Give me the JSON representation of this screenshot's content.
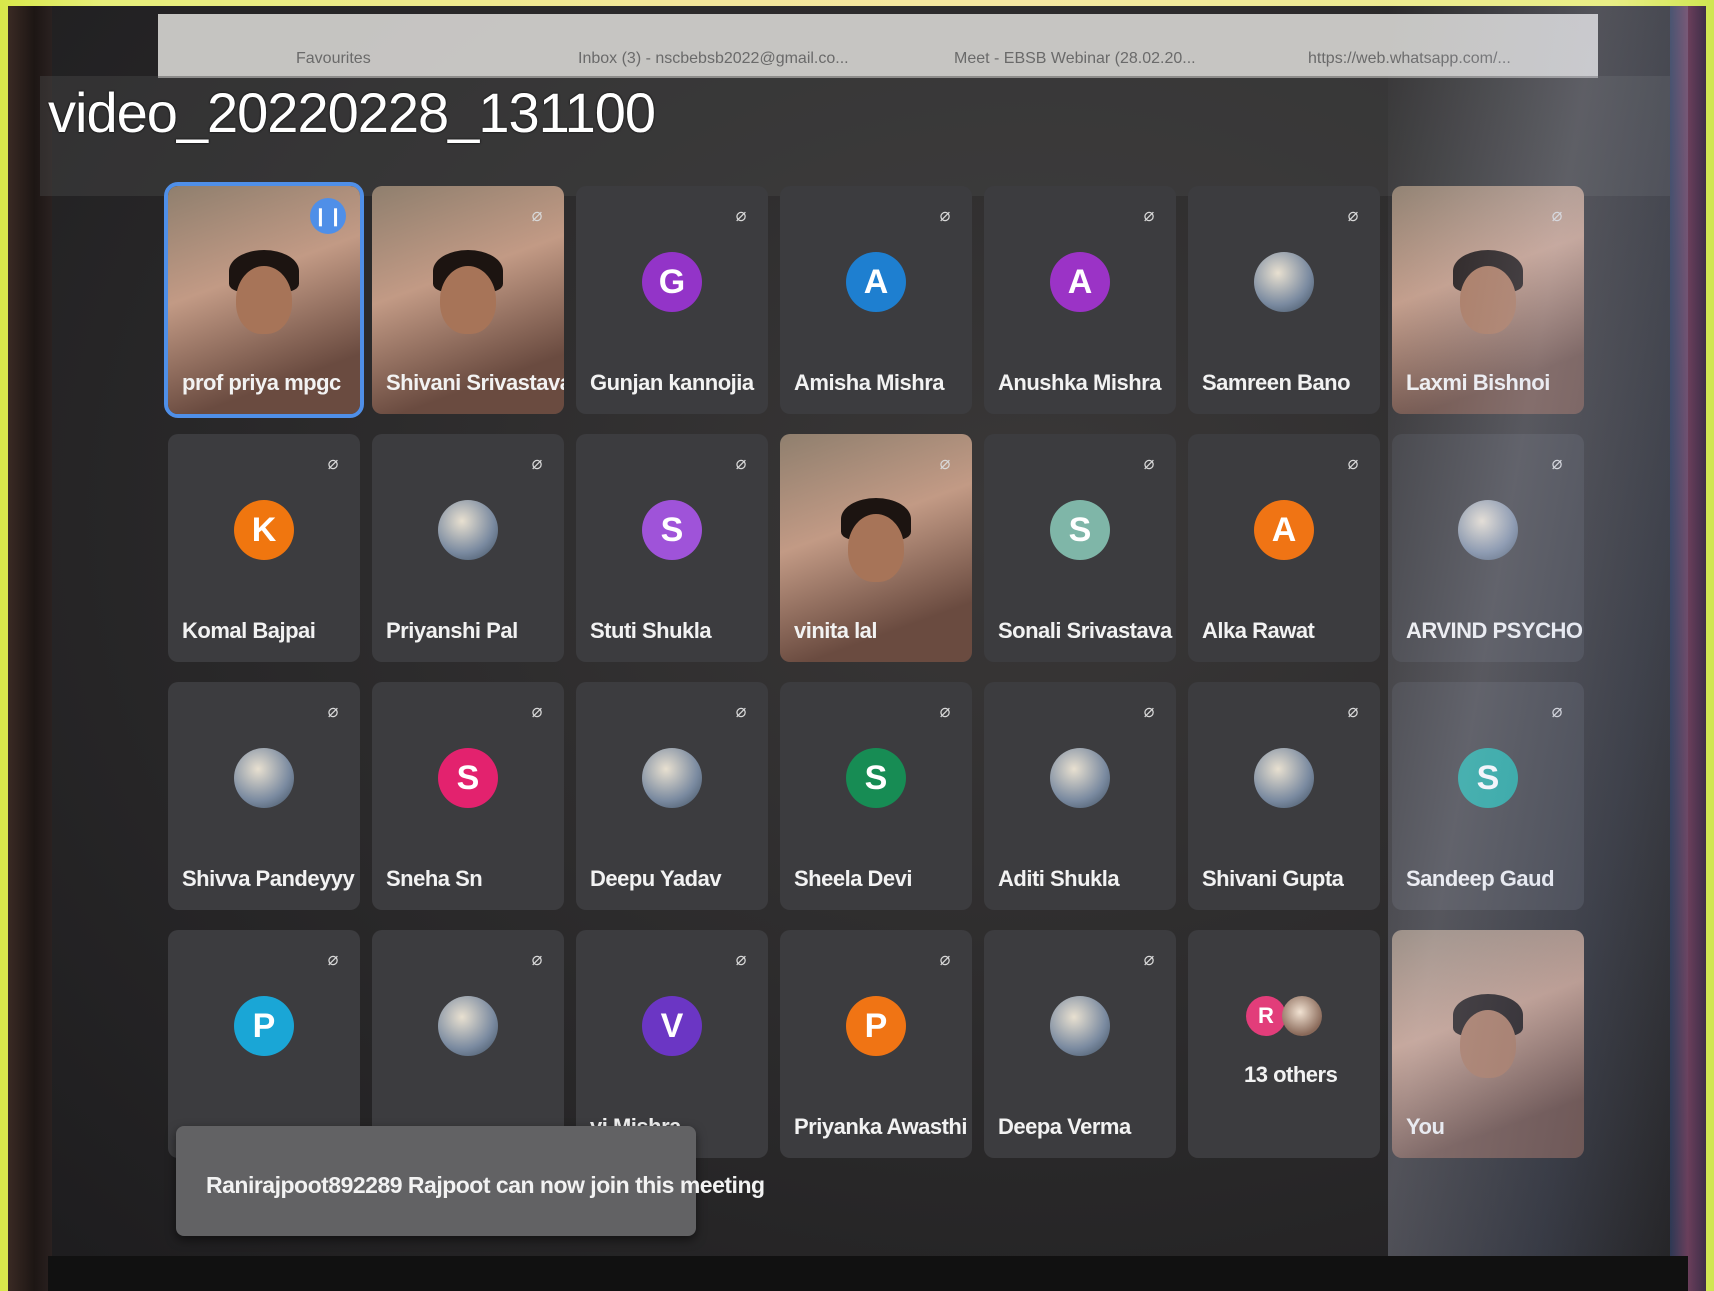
{
  "video_title": "video_20220228_131100",
  "browser": {
    "bookmarks": [
      {
        "label": "Favourites"
      },
      {
        "label": "Inbox (3) - nscbebsb2022@gmail.co..."
      },
      {
        "label": "Meet - EBSB Webinar (28.02.20..."
      },
      {
        "label": "https://web.whatsapp.com/..."
      }
    ]
  },
  "participants": [
    {
      "name": "prof priya mpgc",
      "type": "video",
      "speaking": true
    },
    {
      "name": "Shivani Srivastava",
      "type": "video"
    },
    {
      "name": "Gunjan kannojia",
      "type": "letter",
      "letter": "G",
      "color": "#9334c8"
    },
    {
      "name": "Amisha Mishra",
      "type": "letter",
      "letter": "A",
      "color": "#1e7fd0"
    },
    {
      "name": "Anushka Mishra",
      "type": "letter",
      "letter": "A",
      "color": "#9b33c6"
    },
    {
      "name": "Samreen Bano",
      "type": "image"
    },
    {
      "name": "Laxmi Bishnoi",
      "type": "video"
    },
    {
      "name": "Komal Bajpai",
      "type": "letter",
      "letter": "K",
      "color": "#f0760f"
    },
    {
      "name": "Priyanshi Pal",
      "type": "image"
    },
    {
      "name": "Stuti Shukla",
      "type": "letter",
      "letter": "S",
      "color": "#9f53d9"
    },
    {
      "name": "vinita lal",
      "type": "video"
    },
    {
      "name": "Sonali Srivastava",
      "type": "letter",
      "letter": "S",
      "color": "#7fb6a8"
    },
    {
      "name": "Alka Rawat",
      "type": "letter",
      "letter": "A",
      "color": "#f07414"
    },
    {
      "name": "ARVIND PSYCHO...",
      "type": "image"
    },
    {
      "name": "Shivva Pandeyyy",
      "type": "image"
    },
    {
      "name": "Sneha Sn",
      "type": "letter",
      "letter": "S",
      "color": "#e3226e"
    },
    {
      "name": "Deepu Yadav",
      "type": "image"
    },
    {
      "name": "Sheela Devi",
      "type": "letter",
      "letter": "S",
      "color": "#178c54"
    },
    {
      "name": "Aditi Shukla",
      "type": "image"
    },
    {
      "name": "Shivani Gupta",
      "type": "image"
    },
    {
      "name": "Sandeep Gaud",
      "type": "letter",
      "letter": "S",
      "color": "#1aa39a"
    },
    {
      "name": "",
      "type": "letter",
      "letter": "P",
      "color": "#1aa6d6"
    },
    {
      "name": "",
      "type": "image"
    },
    {
      "name": "vi Mishra",
      "type": "letter",
      "letter": "V",
      "color": "#6b36c4"
    },
    {
      "name": "Priyanka Awasthi",
      "type": "letter",
      "letter": "P",
      "color": "#f07414"
    },
    {
      "name": "Deepa Verma",
      "type": "image"
    },
    {
      "name": "13 others",
      "type": "others",
      "letter": "R",
      "color": "#e23d7a"
    },
    {
      "name": "You",
      "type": "video"
    }
  ],
  "notification": {
    "text": "Ranirajpoot892289 Rajpoot can now join this meeting"
  }
}
